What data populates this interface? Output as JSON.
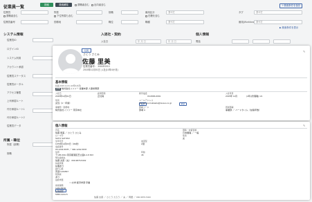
{
  "page_title": "従業員一覧",
  "toolbar": {
    "tab_active": "検索",
    "tab_second": "検索解除",
    "check1": "退職者含む",
    "check2": "出向者含む",
    "save_condition": "検索条件を保存"
  },
  "filters": {
    "row1": [
      {
        "label": "従業員",
        "field": "従業員",
        "sub": "退職者含む"
      },
      {
        "label": "所属",
        "sub": "下位所属も含む"
      },
      {
        "label": "役職"
      },
      {
        "label": "雇用区分",
        "sub": "在籍を含む",
        "value": "すべて"
      },
      {
        "label": "タグ",
        "value": "すべて"
      }
    ],
    "row2": [
      {
        "label": "従業員番号"
      },
      {
        "label": "勤務地"
      },
      {
        "label": "職位"
      },
      {
        "label": "職種",
        "value": "すべて"
      },
      {
        "label": "雇用(Workforce)",
        "value": "すべて"
      }
    ],
    "more_link": "▶ 検索条件を表示"
  },
  "left_panel": {
    "system_info_title": "システム情報",
    "system_rows": [
      "従業員ID",
      "ログインID",
      "システム利用",
      "アカウント承認",
      "従業員ステータス",
      "従業員ポータル",
      "アクセス権限",
      "上司承認ルート",
      "代行承認ルート1",
      "代行承認ルート2",
      "従業員データ"
    ],
    "org_title": "所属・職位",
    "org_rows": [
      "所属（部署）",
      "役職"
    ]
  },
  "mid_panel": {
    "title": "入退社・契約",
    "date_label": "入社日",
    "date_placeholder": "年 月 日"
  },
  "right_panel": {
    "title": "個人情報",
    "label1": "電話",
    "col1": "項目",
    "col2": "内容"
  },
  "profile": {
    "role_badge": "社員",
    "furigana": "さとう さとみ",
    "name": "佐藤 里美",
    "emp_no": "従業員番号： 3080E0010",
    "hire": "2015年11月01日 入社(10年4か月)",
    "basic_title": "基本情報",
    "basic_meta": "社員 2015.11.01 (10年4か月)",
    "dept_badge": "部署",
    "dept": "株式会社イソソー 営業本部 人事総務部",
    "grid": [
      {
        "k": "入社日",
        "v": "2015年11月01日"
      },
      {
        "k": "雇用形態",
        "v": "正社員"
      },
      {
        "k": "携帯電話",
        "v": "03-6666-0001"
      },
      {
        "k": "入社年月",
        "v": "2015年 11月"
      },
      {
        "k": "性別",
        "v": "女性（4・年齢）"
      },
      {
        "k": "メールアドレス",
        "v": "yamamoto.hokkaido@isosoo.co.jp"
      },
      {
        "k": "事業所・勤務地",
        "v": "株式会社イソソー 東京本社"
      },
      {
        "k": "部署コード",
        "v": "部署 A"
      },
      {
        "k": "所属部署",
        "v": "事業部 ／ ハードタイム（在籍年数）"
      }
    ],
    "grid_badges": [
      "電話",
      "承認"
    ],
    "grid_extra": "(4年)(管理職) 1/1",
    "personal_title": "個人情報",
    "personal_rows": [
      {
        "k": "氏名",
        "v": "佐藤 里美 ／ さとう さとみ"
      },
      {
        "k": "ローマ字",
        "v": "SATO SATOMI"
      },
      {
        "k": "生年月日",
        "v": "1979年11月03日（46歳）"
      },
      {
        "k": "電話番号",
        "v": "03-1234-5678 ／ 090-1234-5678"
      },
      {
        "k": "住所",
        "v": "〒105-0011 東京都港区芝公園4-2-8 303"
      },
      {
        "k": "緊急連絡先",
        "v": "佐藤 太郎（夫） 090-9876-5432"
      },
      {
        "k": "扶養家族",
        "v": "扶養あり"
      },
      {
        "k": "銀行口座",
        "v": "普通 1234567"
      },
      {
        "k": "配偶者",
        "v": "あり"
      },
      {
        "k": "最終学歴",
        "v": "○○大学 経済学部 卒業"
      },
      {
        "k": "健康保険",
        "v": "1234-5678"
      },
      {
        "k": "雇用保険",
        "v": "5050-1234-5"
      }
    ],
    "personal_right": [
      {
        "k": "国籍・在留資格",
        "v": "日本国籍 ／ 一般"
      },
      {
        "k": "性別",
        "v": "女"
      },
      {
        "k": "血液型",
        "v": "A型"
      },
      {
        "k": "年齢",
        "v": "46"
      }
    ],
    "phone_badge": "電話番号",
    "bottom_note": "佐藤 太郎 ／ さとう たろう ／ 夫 ／ 同居 ／ 090-9876-5432"
  },
  "colors": {
    "accent": "#2f8f5b",
    "link": "#3a62a8"
  }
}
